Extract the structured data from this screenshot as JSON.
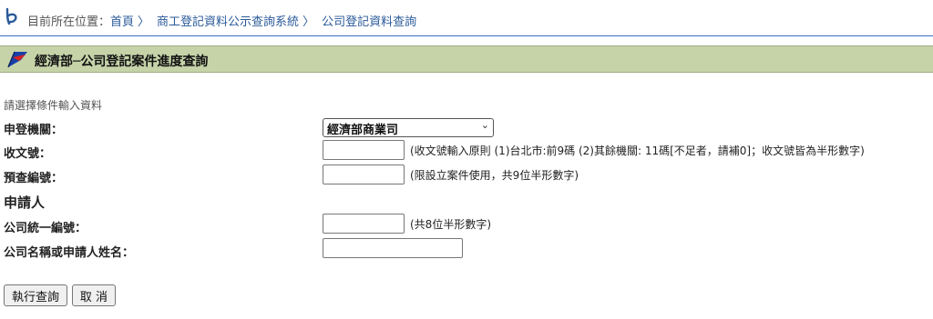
{
  "breadcrumb": {
    "prefix": "目前所在位置：",
    "items": [
      "首頁",
      "商工登記資料公示查詢系統",
      "公司登記資料查詢"
    ],
    "separator": "〉"
  },
  "title": "經濟部─公司登記案件進度查詢",
  "instructions": "請選擇條件輸入資料",
  "fields": {
    "agency": {
      "label": "申登機關：",
      "value": "經濟部商業司"
    },
    "receipt_no": {
      "label": "收文號：",
      "value": "",
      "hint": "(收文號輸入原則 (1)台北市:前9碼 (2)其餘機關: 11碼[不足者，請補0]；收文號皆為半形數字)"
    },
    "precheck_no": {
      "label": "預查編號：",
      "value": "",
      "hint": "(限設立案件使用，共9位半形數字)"
    },
    "applicant_heading": "申請人",
    "company_id": {
      "label": "公司統一編號：",
      "value": "",
      "hint": "(共8位半形數字)"
    },
    "company_name": {
      "label": "公司名稱或申請人姓名：",
      "value": ""
    }
  },
  "buttons": {
    "submit": "執行查詢",
    "cancel": "取 消"
  },
  "colors": {
    "title_bar": "#c6d3a9",
    "link": "#2a5a9a",
    "rule": "#3a6fc4"
  },
  "icons": {
    "breadcrumb": "moea-logo-icon",
    "title": "moea-flag-icon"
  }
}
